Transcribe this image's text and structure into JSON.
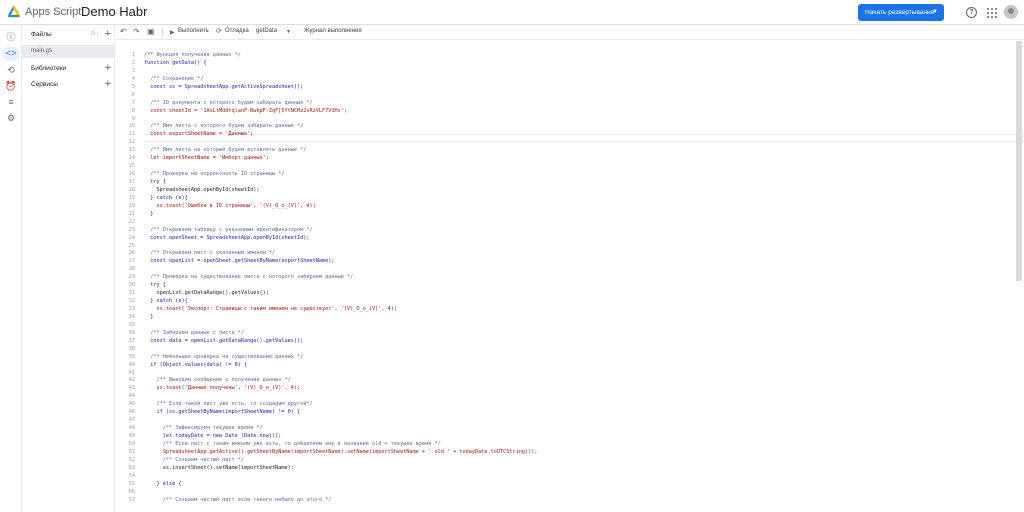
{
  "header": {
    "app_name": "Apps Script",
    "project_title": "Demo Habr",
    "deploy_label": "Начать развертывание",
    "help_glyph": "?"
  },
  "sidebar": {
    "files_label": "Файлы",
    "file_name": "main.gs",
    "libraries_label": "Библиотеки",
    "services_label": "Сервисы",
    "plus_glyph": "+",
    "sort_glyph": "A↓"
  },
  "toolbar": {
    "run_label": "Выполнить",
    "debug_label": "Отладка",
    "function_name": "getData",
    "log_label": "Журнал выполнения"
  },
  "colors": {
    "accent": "#1a73e8",
    "comment": "#5f6b99",
    "keyword": "#1a1aa6",
    "string": "#a31515"
  },
  "code_lines": [
    "/** Функция получения данных */",
    "function getData() {",
    "",
    "  /** Сохранение */",
    "  const ss = SpreadsheetApp.getActiveSpreadsheet();",
    "",
    "  /** ID документа с которого будем забирать данные */",
    "  const sheetId = '1AsLtMddtqlanF-BwkpF-ZqF[5YtNCHz2sRzVLF7V3Hs';",
    "",
    "  /** Имя листа с которого будем забирать данные */",
    "  const exportSheetName = 'Данные';",
    "",
    "  /** Имя листа на который будем вставлять данные */",
    "  let importSheetName = 'Импорт данных';",
    "",
    "  /** Проверка на корректность ID страницы */",
    "  try {",
    "    SpreadsheetApp.openById(sheetId);",
    "  } catch (e){",
    "    ss.toast('Ошибка в ID страницы', '(V)_O_o_(V)', 4);",
    "  }",
    "",
    "  /** Открываем таблицу с указанным идентификатором */",
    "  const openSheet = SpreadsheetApp.openById(sheetId);",
    "",
    "  /** Открываем лист с указанным именем */",
    "  const openList = openSheet.getSheetByName(exportSheetName);",
    "",
    "  /** Проверка на существование листа с которого забираем данные */",
    "  try {",
    "    openList.getDataRange().getValues();",
    "  } catch (e){",
    "    ss.toast('Экспорт: Страницы с таким именем не существует', '(V)_O_o_(V)', 4);",
    "  }",
    "",
    "  /** Забираем данные с листа */",
    "  const data = openList.getDataRange().getValues();",
    "",
    "  /** Небольшая проверка на существование данных */",
    "  if (Object.values(data) != 0) {",
    "",
    "    /** Выводим сообщение о получении данных */",
    "    ss.toast('Данные получены', '(V)_O_o_(V)', 4);",
    "",
    "    /** Если такой лист уже есть, то создадим другой*/",
    "    if (ss.getSheetByName(importSheetName) != 0) {",
    "",
    "      /** Зафиксируем текущее время */",
    "      let todayDate = new Date (Date.now());",
    "      /** Если лист с таким именем уже есть, то добавляем ему в название old + текущее время */",
    "      SpreadsheetApp.getActive().getSheetByName(importSheetName).setName(importSheetName + ' old ' + todayDate.toUTCString());",
    "      /** Создаем чистый лист */",
    "      ss.insertSheet().setName(importSheetName);",
    "",
    "    } else {",
    "",
    "      /** Создаем чистый лист если такого небыло до этого */"
  ]
}
